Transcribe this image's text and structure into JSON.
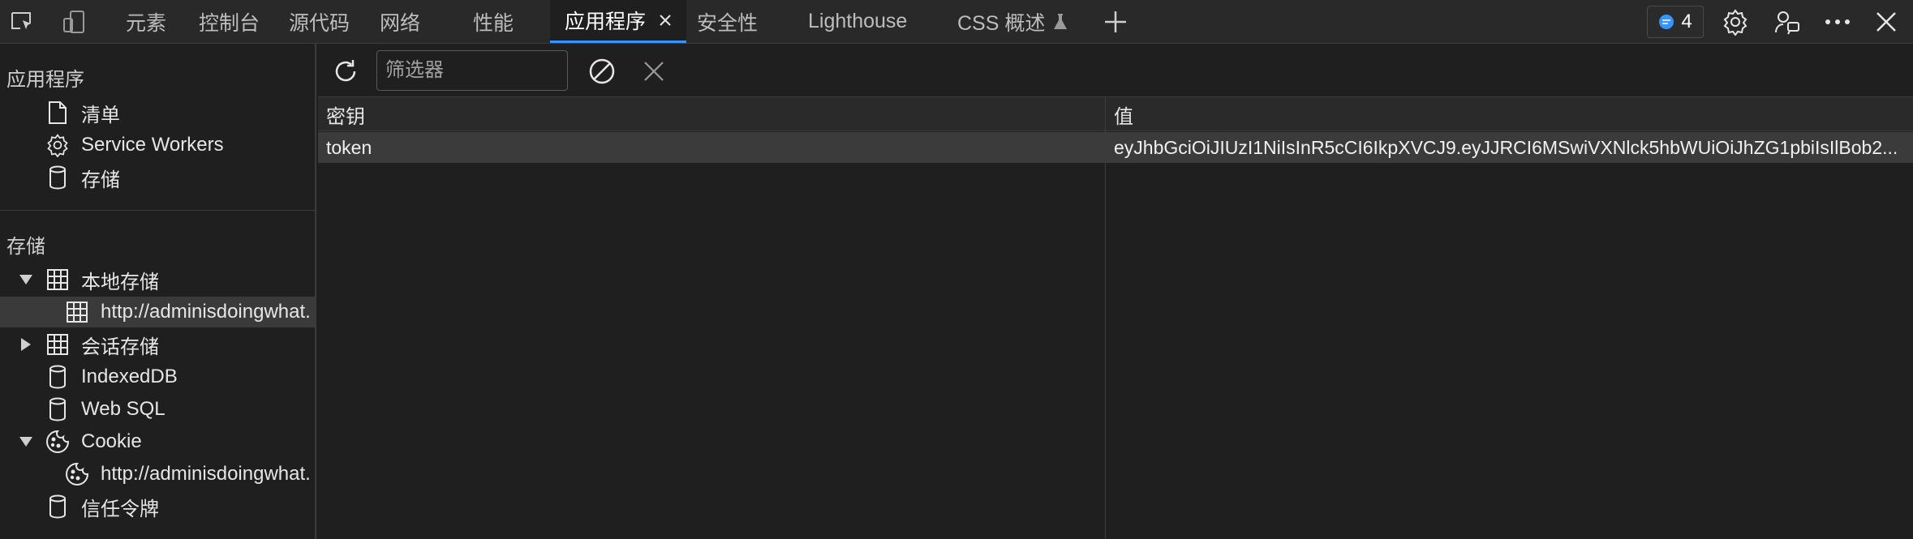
{
  "toolbar_left": {
    "inspect_icon": "inspect-icon",
    "device_icon": "device-emulation-icon"
  },
  "tabs": [
    {
      "label": "元素"
    },
    {
      "label": "控制台"
    },
    {
      "label": "源代码"
    },
    {
      "label": "网络"
    },
    {
      "label": "性能"
    },
    {
      "label": "应用程序",
      "active": true
    },
    {
      "label": "安全性"
    },
    {
      "label": "Lighthouse"
    },
    {
      "label": "CSS 概述"
    }
  ],
  "issues_badge": {
    "count": "4"
  },
  "sidebar": {
    "app_section": "应用程序",
    "app_items": [
      {
        "label": "清单",
        "icon": "file-icon"
      },
      {
        "label": "Service Workers",
        "icon": "gear-icon"
      },
      {
        "label": "存储",
        "icon": "database-icon"
      }
    ],
    "storage_section": "存储",
    "storage_items": [
      {
        "label": "本地存储",
        "icon": "grid-icon",
        "expanded": true
      },
      {
        "label": "http://adminisdoingwhat.",
        "icon": "grid-icon",
        "selected": true
      },
      {
        "label": "会话存储",
        "icon": "grid-icon",
        "expanded": false
      },
      {
        "label": "IndexedDB",
        "icon": "database-icon"
      },
      {
        "label": "Web SQL",
        "icon": "database-icon"
      },
      {
        "label": "Cookie",
        "icon": "cookie-icon",
        "expanded": true
      },
      {
        "label": "http://adminisdoingwhat.",
        "icon": "cookie-icon"
      },
      {
        "label": "信任令牌",
        "icon": "database-icon"
      }
    ]
  },
  "main": {
    "filter_placeholder": "筛选器",
    "columns": [
      "密钥",
      "值"
    ],
    "rows": [
      {
        "key": "token",
        "value": "eyJhbGciOiJIUzI1NiIsInR5cCI6IkpXVCJ9.eyJJRCI6MSwiVXNlck5hbWUiOiJhZG1pbiIsIlBob2..."
      }
    ]
  },
  "colors": {
    "accent": "#3794ff",
    "badge_icon": "#3794ff"
  }
}
